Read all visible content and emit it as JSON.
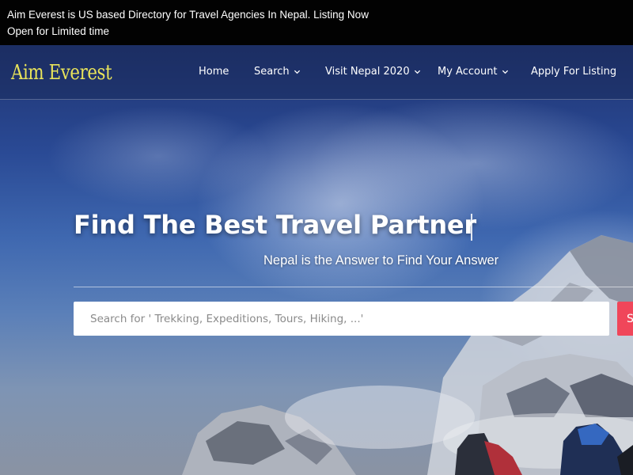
{
  "announcement": {
    "line1": "Aim Everest is US based Directory for Travel Agencies In Nepal. Listing Now",
    "line2": "Open for Limited time"
  },
  "nav": {
    "logo": "Aim Everest",
    "items": [
      {
        "label": "Home"
      },
      {
        "label": "Search"
      },
      {
        "label": "Visit Nepal 2020"
      },
      {
        "label": "My Account"
      },
      {
        "label": "Apply For Listing"
      }
    ]
  },
  "hero": {
    "title": "Find The Best Travel Partner",
    "subtitle": "Nepal is the Answer to Find Your Answer",
    "search_placeholder": "Search for ' Trekking, Expeditions, Tours, Hiking, ...'",
    "search_button_label": "Search"
  },
  "colors": {
    "logo": "#e8e35a",
    "search_button": "#f0465a",
    "announcement_bg": "#020202"
  },
  "icons": {
    "dropdown": "chevron-down-icon"
  }
}
